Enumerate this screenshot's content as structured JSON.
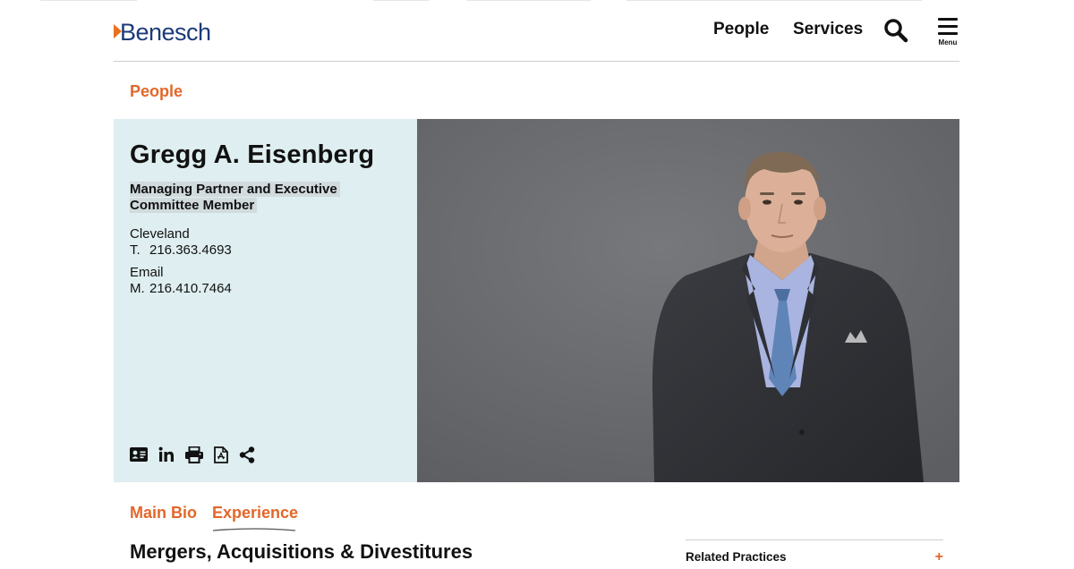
{
  "header": {
    "logo_text": "Benesch",
    "nav": {
      "people": "People",
      "services": "Services"
    },
    "menu_label": "Menu",
    "brand_orange": "#e2672a",
    "brand_blue": "#1d3a7a"
  },
  "breadcrumb": "People",
  "profile": {
    "name": "Gregg A. Eisenberg",
    "title": "Managing Partner and Executive Committee Member",
    "office": "Cleveland",
    "phone_prefix": "T.",
    "phone": "216.363.4693",
    "email_label": "Email",
    "mobile_prefix": "M.",
    "mobile": "216.410.7464",
    "actions": [
      "vcard-icon",
      "linkedin-icon",
      "print-icon",
      "pdf-icon",
      "share-icon"
    ]
  },
  "tabs": {
    "main_bio": "Main Bio",
    "experience": "Experience"
  },
  "section_title": "Mergers, Acquisitions & Divestitures",
  "related": {
    "heading": "Related Practices",
    "toggle": "+"
  }
}
